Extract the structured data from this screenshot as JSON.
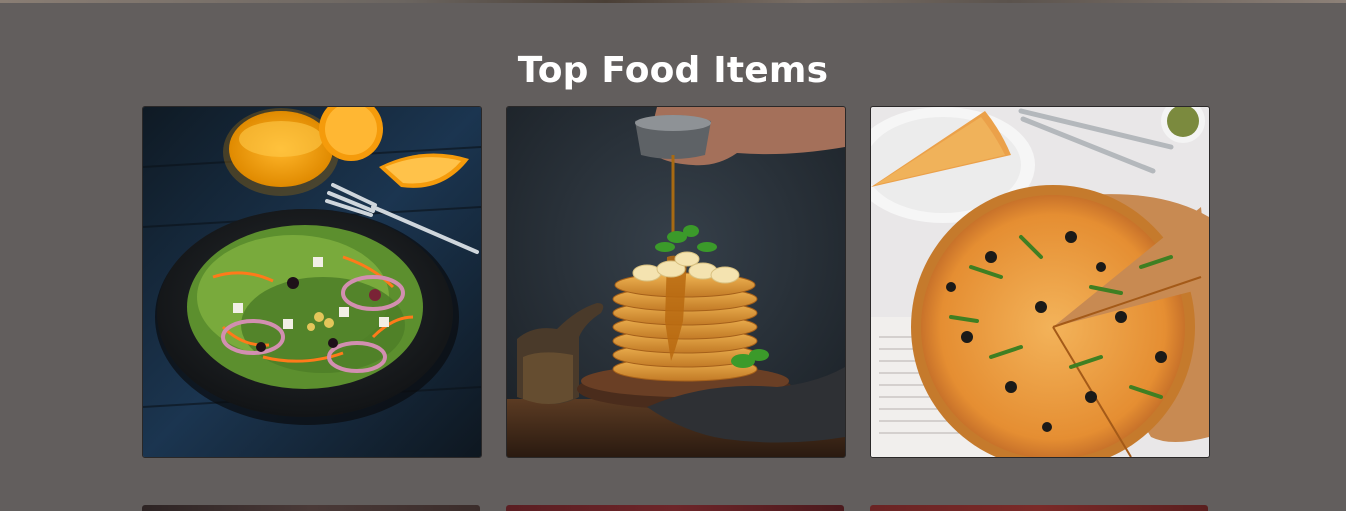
{
  "section": {
    "title": "Top Food Items"
  },
  "items": [
    {
      "image_alt": "salad",
      "icon": "salad-image"
    },
    {
      "image_alt": "pancakes",
      "icon": "pancakes-image"
    },
    {
      "image_alt": "pizza",
      "icon": "pizza-image"
    }
  ],
  "colors": {
    "background": "#625e5d",
    "title": "#ffffff"
  }
}
